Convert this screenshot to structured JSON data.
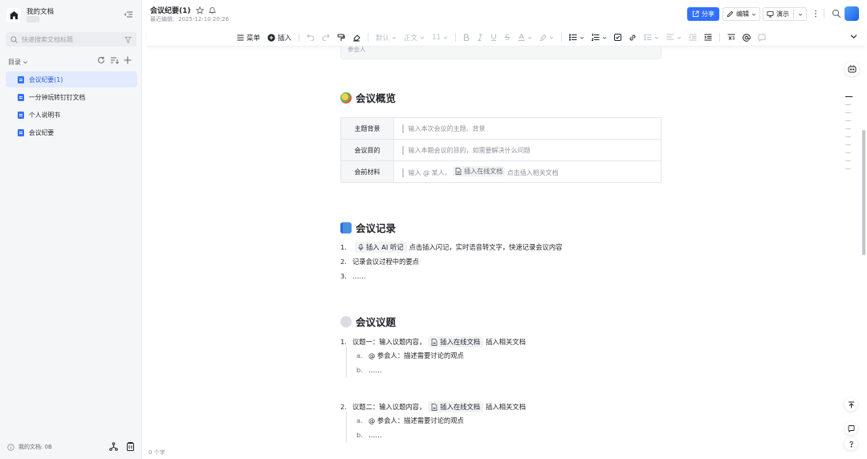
{
  "sidebar": {
    "title": "我的文档",
    "search_placeholder": "快速搜索文档标题",
    "directory_label": "目录",
    "items": [
      {
        "label": "会议纪要(1)",
        "active": true
      },
      {
        "label": "一分钟玩转钉钉文档",
        "active": false
      },
      {
        "label": "个人说明书",
        "active": false
      },
      {
        "label": "会议纪要",
        "active": false
      }
    ],
    "footer_label": "我的文档: 0B"
  },
  "header": {
    "doc_title": "会议纪要(1)",
    "last_edited": "最近编辑：2025-12-10 20:26",
    "share_label": "分享",
    "edit_label": "编辑",
    "present_label": "演示"
  },
  "toolbar": {
    "menu_label": "菜单",
    "insert_label": "插入",
    "font_default": "默认",
    "paragraph_label": "正文",
    "font_size": "11"
  },
  "content": {
    "callout_remnant_text": "参会人",
    "overview": {
      "heading": "会议概览",
      "rows": [
        {
          "key": "主题背景",
          "value": "输入本次会议的主题、背景"
        },
        {
          "key": "会议目的",
          "value": "输入本期会议的目的，如需要解决什么问题"
        },
        {
          "key": "会前材料",
          "value_prefix": "输入 @ 某人，",
          "chip": "插入在线文档",
          "value_suffix": "点击插入相关文档"
        }
      ]
    },
    "records": {
      "heading": "会议记录",
      "items": [
        {
          "num": "1.",
          "chip": "插入 AI 听记",
          "text": "点击插入闪记，实时语音转文字，快速记录会议内容"
        },
        {
          "num": "2.",
          "text": "记录会议过程中的要点"
        },
        {
          "num": "3.",
          "text": "……"
        }
      ]
    },
    "topics": {
      "heading": "会议议题",
      "items": [
        {
          "num": "1.",
          "prefix": "议题一：输入议题内容，",
          "chip": "插入在线文档",
          "suffix": "插入相关文档",
          "subs": [
            {
              "num": "a.",
              "text": "@ 参会人：描述需要讨论的观点"
            },
            {
              "num": "b.",
              "text": "……"
            }
          ]
        },
        {
          "num": "2.",
          "prefix": "议题二：输入议题内容，",
          "chip": "插入在线文档",
          "suffix": "插入相关文档",
          "subs": [
            {
              "num": "a.",
              "text": "@ 参会人：描述需要讨论的观点"
            },
            {
              "num": "b.",
              "text": "……"
            }
          ]
        }
      ]
    }
  },
  "footer": {
    "word_count": "0 个字"
  },
  "colors": {
    "accent": "#3370ff",
    "sidebar_bg": "#f5f6f7",
    "active_bg": "#e1eaff"
  }
}
